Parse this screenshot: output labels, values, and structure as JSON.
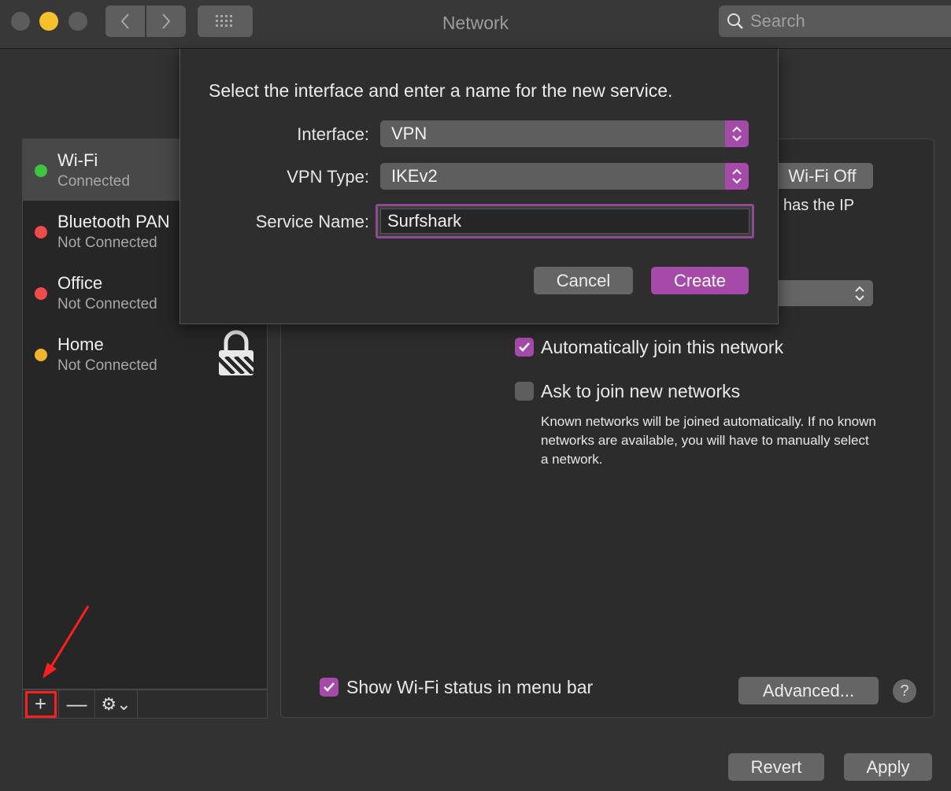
{
  "window": {
    "title": "Network",
    "search_placeholder": "Search"
  },
  "sidebar": {
    "services": [
      {
        "name": "Wi-Fi",
        "status": "Connected",
        "status_color": "#3ec43e",
        "selected": true
      },
      {
        "name": "Bluetooth PAN",
        "status": "Not Connected",
        "status_color": "#f04a4a"
      },
      {
        "name": "Office",
        "status": "Not Connected",
        "status_color": "#f04a4a"
      },
      {
        "name": "Home",
        "status": "Not Connected",
        "status_color": "#f0b52a",
        "icon": "lock-icon"
      }
    ],
    "toolbar": {
      "add_label": "+",
      "remove_label": "—",
      "action_label": "⚙⌄"
    }
  },
  "main": {
    "wifi_off_button": "Wi-Fi Off",
    "partial_text": "has the IP",
    "auto_join": {
      "label": "Automatically join this network",
      "checked": true
    },
    "ask_join": {
      "label": "Ask to join new networks",
      "checked": false
    },
    "help_text": "Known networks will be joined automatically. If no known networks are available, you will have to manually select a network.",
    "show_status": {
      "label": "Show Wi-Fi status in menu bar",
      "checked": true
    },
    "advanced_button": "Advanced...",
    "help_button": "?"
  },
  "footer": {
    "revert_button": "Revert",
    "apply_button": "Apply"
  },
  "dialog": {
    "title": "Select the interface and enter a name for the new service.",
    "interface_label": "Interface:",
    "interface_value": "VPN",
    "vpn_type_label": "VPN Type:",
    "vpn_type_value": "IKEv2",
    "service_name_label": "Service Name:",
    "service_name_value": "Surfshark",
    "cancel_button": "Cancel",
    "create_button": "Create"
  },
  "colors": {
    "accent": "#a64aaa",
    "annotation": "#ff1f1f"
  }
}
